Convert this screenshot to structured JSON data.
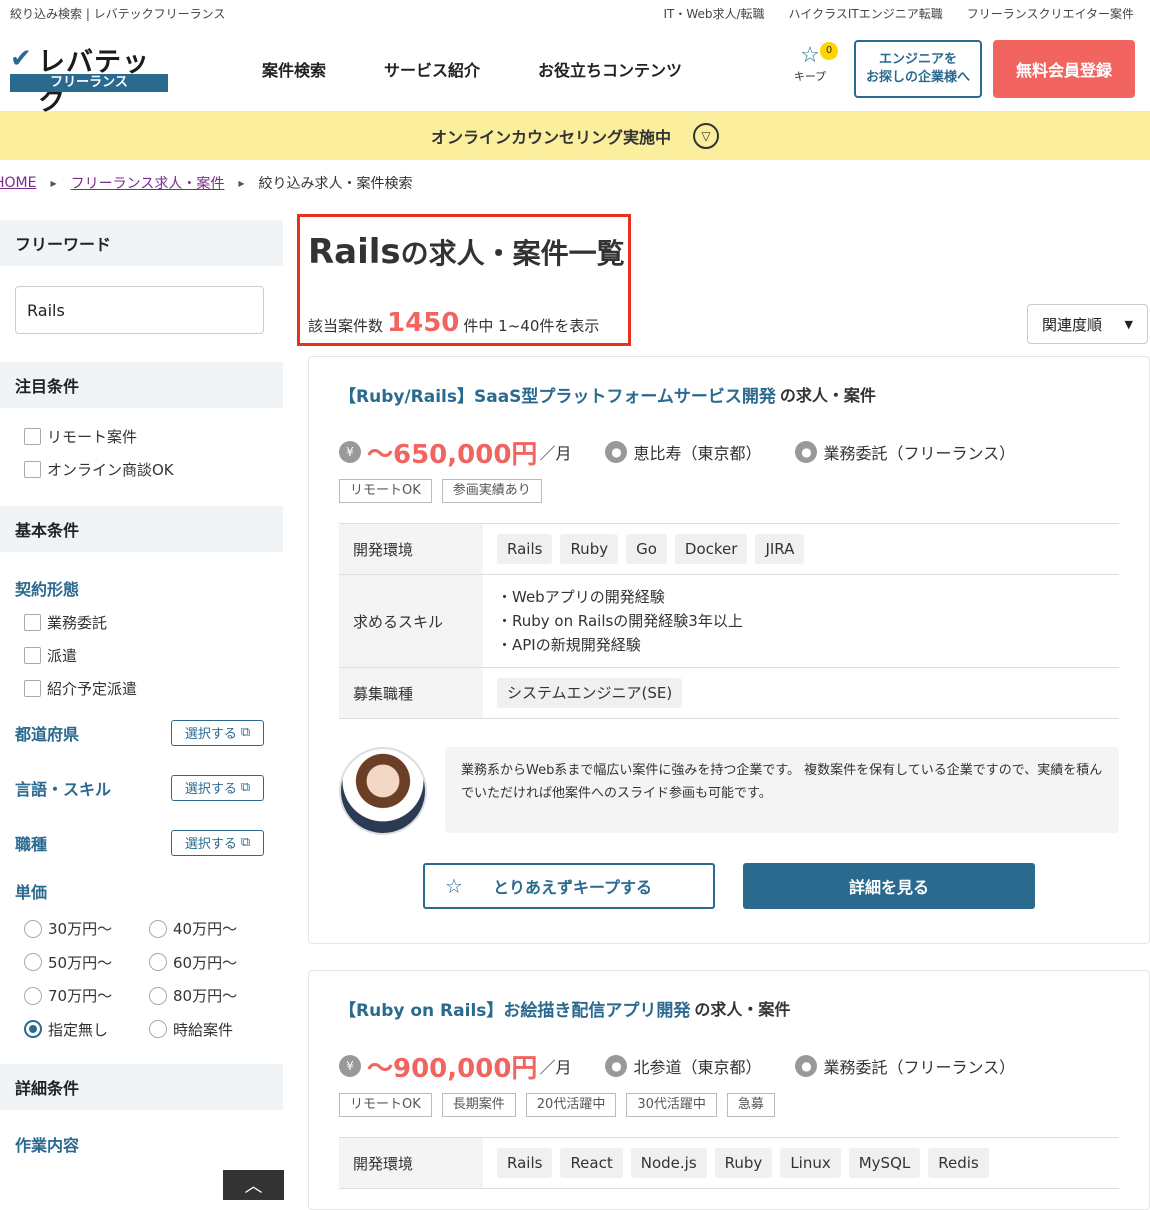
{
  "topbar": {
    "page_label": "絞り込み検索 | レバテックフリーランス",
    "links": [
      "IT・Web求人/転職",
      "ハイクラスITエンジニア転職",
      "フリーランスクリエイター案件"
    ]
  },
  "header": {
    "logo_brand": "レバテック",
    "logo_sub": "フリーランス",
    "nav": [
      "案件検索",
      "サービス紹介",
      "お役立ちコンテンツ"
    ],
    "keep_label": "キープ",
    "keep_count": "0",
    "corp_button": "エンジニアを\nお探しの企業様へ",
    "register_button": "無料会員登録"
  },
  "banner": {
    "text": "オンラインカウンセリング実施中"
  },
  "breadcrumb": {
    "home": "HOME",
    "list": "フリーランス求人・案件",
    "current": "絞り込み求人・案件検索"
  },
  "sidebar": {
    "freeword": {
      "heading": "フリーワード",
      "value": "Rails"
    },
    "featured": {
      "heading": "注目条件",
      "options": [
        "リモート案件",
        "オンライン商談OK"
      ]
    },
    "basic": {
      "heading": "基本条件",
      "contract_heading": "契約形態",
      "contract_options": [
        "業務委託",
        "派遣",
        "紹介予定派遣"
      ],
      "pref_label": "都道府県",
      "skill_label": "言語・スキル",
      "job_label": "職種",
      "select_label": "選択する",
      "price_heading": "単価",
      "price_options": [
        "30万円〜",
        "40万円〜",
        "50万円〜",
        "60万円〜",
        "70万円〜",
        "80万円〜",
        "指定無し",
        "時給案件"
      ],
      "price_selected": "指定無し"
    },
    "detail": {
      "heading": "詳細条件",
      "work_label": "作業内容"
    }
  },
  "main": {
    "title_keyword": "Rails",
    "title_rest": "の求人・案件一覧",
    "count_prefix": "該当案件数",
    "count": "1450",
    "count_suffix": "件中 1~40件を表示",
    "sort": "関連度順"
  },
  "jobs": [
    {
      "title": "【Ruby/Rails】SaaS型プラットフォームサービス開発",
      "suffix": "の求人・案件",
      "price": "〜650,000円",
      "unit": "／月",
      "location": "恵比寿（東京都）",
      "contract": "業務委託（フリーランス）",
      "tags": [
        "リモートOK",
        "参画実績あり"
      ],
      "env_label": "開発環境",
      "env": [
        "Rails",
        "Ruby",
        "Go",
        "Docker",
        "JIRA"
      ],
      "skills_label": "求めるスキル",
      "skills": [
        "・Webアプリの開発経験",
        "・Ruby on Railsの開発経験3年以上",
        "・APIの新規開発経験"
      ],
      "role_label": "募集職種",
      "role": "システムエンジニア(SE)",
      "agent_comment": "業務系からWeb系まで幅広い案件に強みを持つ企業です。 複数案件を保有している企業ですので、実績を積んでいただければ他案件へのスライド参画も可能です。",
      "keep_button": "とりあえずキープする",
      "detail_button": "詳細を見る"
    },
    {
      "title": "【Ruby on Rails】お絵描き配信アプリ開発",
      "suffix": "の求人・案件",
      "price": "〜900,000円",
      "unit": "／月",
      "location": "北参道（東京都）",
      "contract": "業務委託（フリーランス）",
      "tags": [
        "リモートOK",
        "長期案件",
        "20代活躍中",
        "30代活躍中",
        "急募"
      ],
      "env_label": "開発環境",
      "env": [
        "Rails",
        "React",
        "Node.js",
        "Ruby",
        "Linux",
        "MySQL",
        "Redis"
      ]
    }
  ],
  "colors": {
    "accent": "#2b6a8f",
    "price": "#f2645f",
    "banner": "#fbef9e",
    "highlight": "#e8301e"
  }
}
